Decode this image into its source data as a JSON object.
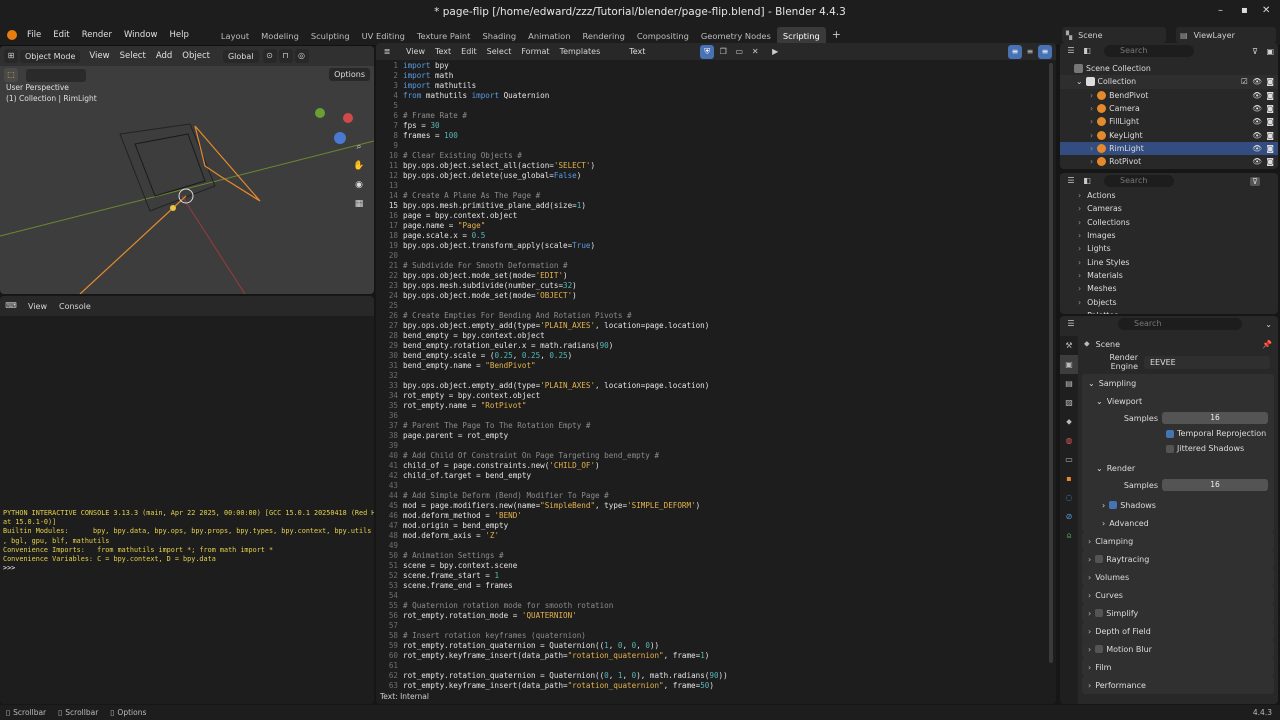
{
  "title_bar": {
    "title": "* page-flip [/home/edward/zzz/Tutorial/blender/page-flip.blend] - Blender 4.4.3"
  },
  "menus": [
    "File",
    "Edit",
    "Render",
    "Window",
    "Help"
  ],
  "workspaces": [
    "Layout",
    "Modeling",
    "Sculpting",
    "UV Editing",
    "Texture Paint",
    "Shading",
    "Animation",
    "Rendering",
    "Compositing",
    "Geometry Nodes",
    "Scripting"
  ],
  "active_workspace": "Scripting",
  "scene_label": "Scene",
  "viewlayer_label": "ViewLayer",
  "viewport": {
    "mode": "Object Mode",
    "menus": [
      "View",
      "Select",
      "Add",
      "Object"
    ],
    "transform": "Global",
    "options": "Options",
    "overlay_title": "User Perspective",
    "overlay_sub": "(1) Collection | RimLight"
  },
  "console": {
    "menus": [
      "View",
      "Console"
    ],
    "lines": [
      "PYTHON INTERACTIVE CONSOLE 3.13.3 (main, Apr 22 2025, 00:00:00) [GCC 15.0.1 20250418 (Red H",
      "at 15.0.1-0)]",
      "",
      "Builtin Modules:      bpy, bpy.data, bpy.ops, bpy.props, bpy.types, bpy.context, bpy.utils",
      ", bgl, gpu, blf, mathutils",
      "Convenience Imports:   from mathutils import *; from math import *",
      "Convenience Variables: C = bpy.context, D = bpy.data",
      "",
      ">>> "
    ]
  },
  "editor": {
    "menus": [
      "View",
      "Text",
      "Edit",
      "Select",
      "Format",
      "Templates"
    ],
    "text_name": "Text",
    "footer": "Text: Internal",
    "lines": [
      "import bpy",
      "import math",
      "import mathutils",
      "from mathutils import Quaternion",
      "",
      "# Frame Rate #",
      "fps = 30",
      "frames = 100",
      "",
      "# Clear Existing Objects #",
      "bpy.ops.object.select_all(action='SELECT')",
      "bpy.ops.object.delete(use_global=False)",
      "",
      "# Create A Plane As The Page #",
      "bpy.ops.mesh.primitive_plane_add(size=1)",
      "page = bpy.context.object",
      "page.name = \"Page\"",
      "page.scale.x = 0.5",
      "bpy.ops.object.transform_apply(scale=True)",
      "",
      "# Subdivide For Smooth Deformation #",
      "bpy.ops.object.mode_set(mode='EDIT')",
      "bpy.ops.mesh.subdivide(number_cuts=32)",
      "bpy.ops.object.mode_set(mode='OBJECT')",
      "",
      "# Create Empties For Bending And Rotation Pivots #",
      "bpy.ops.object.empty_add(type='PLAIN_AXES', location=page.location)",
      "bend_empty = bpy.context.object",
      "bend_empty.rotation_euler.x = math.radians(90)",
      "bend_empty.scale = (0.25, 0.25, 0.25)",
      "bend_empty.name = \"BendPivot\"",
      "",
      "bpy.ops.object.empty_add(type='PLAIN_AXES', location=page.location)",
      "rot_empty = bpy.context.object",
      "rot_empty.name = \"RotPivot\"",
      "",
      "# Parent The Page To The Rotation Empty #",
      "page.parent = rot_empty",
      "",
      "# Add Child Of Constraint On Page Targeting bend_empty #",
      "child_of = page.constraints.new('CHILD_OF')",
      "child_of.target = bend_empty",
      "",
      "# Add Simple Deform (Bend) Modifier To Page #",
      "mod = page.modifiers.new(name=\"SimpleBend\", type='SIMPLE_DEFORM')",
      "mod.deform_method = 'BEND'",
      "mod.origin = bend_empty",
      "mod.deform_axis = 'Z'",
      "",
      "# Animation Settings #",
      "scene = bpy.context.scene",
      "scene.frame_start = 1",
      "scene.frame_end = frames",
      "",
      "# Quaternion rotation mode for smooth rotation",
      "rot_empty.rotation_mode = 'QUATERNION'",
      "",
      "# Insert rotation keyframes (quaternion)",
      "rot_empty.rotation_quaternion = Quaternion((1, 0, 0, 0))",
      "rot_empty.keyframe_insert(data_path=\"rotation_quaternion\", frame=1)",
      "",
      "rot_empty.rotation_quaternion = Quaternion((0, 1, 0), math.radians(90))",
      "rot_empty.keyframe_insert(data_path=\"rotation_quaternion\", frame=50)"
    ]
  },
  "outliner": {
    "search_placeholder": "Search",
    "scene_collection": "Scene Collection",
    "collection": "Collection",
    "objects": [
      "BendPivot",
      "Camera",
      "FillLight",
      "KeyLight",
      "RimLight",
      "RotPivot"
    ],
    "selected": "RimLight"
  },
  "data_browser": {
    "search_placeholder": "Search",
    "items": [
      "Actions",
      "Cameras",
      "Collections",
      "Images",
      "Lights",
      "Line Styles",
      "Materials",
      "Meshes",
      "Objects",
      "Palettes"
    ]
  },
  "properties": {
    "search_placeholder": "Search",
    "scene": "Scene",
    "render_engine_label": "Render Engine",
    "render_engine": "EEVEE",
    "sampling": "Sampling",
    "viewport": "Viewport",
    "samples_label": "Samples",
    "viewport_samples": "16",
    "temporal_reprojection": "Temporal Reprojection",
    "jittered_shadows": "Jittered Shadows",
    "render": "Render",
    "render_samples": "16",
    "shadows": "Shadows",
    "advanced": "Advanced",
    "sections": [
      "Clamping",
      "Raytracing",
      "Volumes",
      "Curves",
      "Simplify",
      "Depth of Field",
      "Motion Blur",
      "Film",
      "Performance"
    ]
  },
  "status_bar": {
    "items": [
      "Scrollbar",
      "Scrollbar",
      "Options"
    ],
    "version": "4.4.3"
  },
  "colors": {
    "accent": "#4772b3",
    "selected_row": "#334d80",
    "keyword": "#5a9ae6",
    "string": "#e6b34d",
    "number": "#57b7b7",
    "comment": "#8b8b8b"
  }
}
